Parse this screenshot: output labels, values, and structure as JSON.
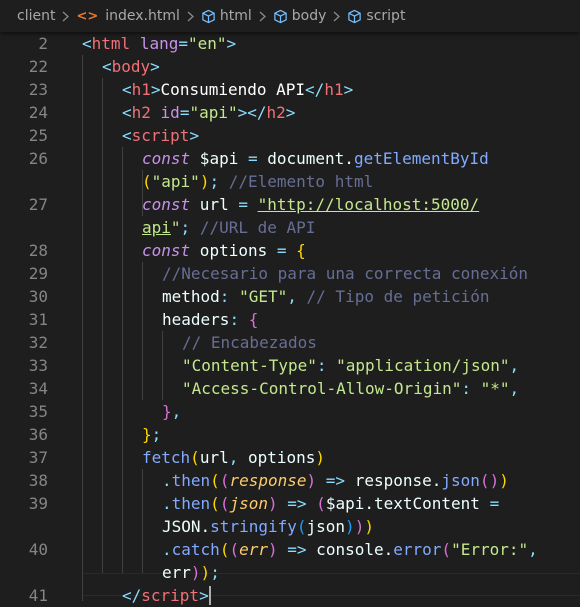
{
  "breadcrumb": {
    "items": [
      "client",
      "index.html",
      "html",
      "body",
      "script"
    ]
  },
  "editor": {
    "lines": [
      {
        "n": "2",
        "tokens": [
          [
            "pun",
            "<"
          ],
          [
            "tagn",
            "html"
          ],
          [
            "txt",
            " "
          ],
          [
            "attr",
            "lang"
          ],
          [
            "pun",
            "="
          ],
          [
            "str",
            "\"en\""
          ],
          [
            "pun",
            ">"
          ]
        ]
      },
      {
        "n": "22",
        "tokens": [
          [
            "pun",
            "<"
          ],
          [
            "tagn",
            "body"
          ],
          [
            "pun",
            ">"
          ]
        ]
      },
      {
        "n": "23",
        "tokens": [
          [
            "pun",
            "<"
          ],
          [
            "tagn",
            "h1"
          ],
          [
            "pun",
            ">"
          ],
          [
            "wt",
            "Consumiendo API"
          ],
          [
            "pun",
            "</"
          ],
          [
            "tagn",
            "h1"
          ],
          [
            "pun",
            ">"
          ]
        ]
      },
      {
        "n": "24",
        "tokens": [
          [
            "pun",
            "<"
          ],
          [
            "tagn",
            "h2"
          ],
          [
            "txt",
            " "
          ],
          [
            "attr",
            "id"
          ],
          [
            "pun",
            "="
          ],
          [
            "str",
            "\"api\""
          ],
          [
            "pun",
            "></"
          ],
          [
            "tagn",
            "h2"
          ],
          [
            "pun",
            ">"
          ]
        ]
      },
      {
        "n": "25",
        "tokens": [
          [
            "pun",
            "<"
          ],
          [
            "tagn",
            "script"
          ],
          [
            "pun",
            ">"
          ]
        ]
      },
      {
        "n": "26",
        "tokens": [
          [
            "kw",
            "const"
          ],
          [
            "txt",
            " $api "
          ],
          [
            "op",
            "="
          ],
          [
            "txt",
            " document."
          ],
          [
            "fn",
            "getElementById"
          ]
        ]
      },
      {
        "n": "",
        "tokens": [
          [
            "br1",
            "("
          ],
          [
            "str",
            "\"api\""
          ],
          [
            "br1",
            ")"
          ],
          [
            "pun",
            ";"
          ],
          [
            "txt",
            " "
          ],
          [
            "cm",
            "//Elemento html"
          ]
        ]
      },
      {
        "n": "27",
        "tokens": [
          [
            "kw",
            "const"
          ],
          [
            "txt",
            " url "
          ],
          [
            "op",
            "="
          ],
          [
            "txt",
            " "
          ],
          [
            "strul",
            "\"http://localhost:5000/"
          ]
        ]
      },
      {
        "n": "",
        "tokens": [
          [
            "strul",
            "api"
          ],
          [
            "str",
            "\""
          ],
          [
            "pun",
            ";"
          ],
          [
            "txt",
            " "
          ],
          [
            "cm",
            "//URL de API"
          ]
        ]
      },
      {
        "n": "28",
        "tokens": [
          [
            "kw",
            "const"
          ],
          [
            "txt",
            " options "
          ],
          [
            "op",
            "="
          ],
          [
            "txt",
            " "
          ],
          [
            "br1",
            "{"
          ]
        ]
      },
      {
        "n": "29",
        "tokens": [
          [
            "cm",
            "//Necesario para una correcta conexión"
          ]
        ]
      },
      {
        "n": "30",
        "tokens": [
          [
            "txt",
            "method"
          ],
          [
            "pun",
            ":"
          ],
          [
            "txt",
            " "
          ],
          [
            "str",
            "\"GET\""
          ],
          [
            "pun",
            ","
          ],
          [
            "txt",
            " "
          ],
          [
            "cm",
            "// Tipo de petición"
          ]
        ]
      },
      {
        "n": "31",
        "tokens": [
          [
            "txt",
            "headers"
          ],
          [
            "pun",
            ":"
          ],
          [
            "txt",
            " "
          ],
          [
            "br2",
            "{"
          ]
        ]
      },
      {
        "n": "32",
        "tokens": [
          [
            "cm",
            "// Encabezados"
          ]
        ]
      },
      {
        "n": "33",
        "tokens": [
          [
            "str",
            "\"Content-Type\""
          ],
          [
            "pun",
            ":"
          ],
          [
            "txt",
            " "
          ],
          [
            "str",
            "\"application/json\""
          ],
          [
            "pun",
            ","
          ]
        ]
      },
      {
        "n": "34",
        "tokens": [
          [
            "str",
            "\"Access-Control-Allow-Origin\""
          ],
          [
            "pun",
            ":"
          ],
          [
            "txt",
            " "
          ],
          [
            "str",
            "\"*\""
          ],
          [
            "pun",
            ","
          ]
        ]
      },
      {
        "n": "35",
        "tokens": [
          [
            "br2",
            "}"
          ],
          [
            "pun",
            ","
          ]
        ]
      },
      {
        "n": "36",
        "tokens": [
          [
            "br1",
            "}"
          ],
          [
            "pun",
            ";"
          ]
        ]
      },
      {
        "n": "37",
        "tokens": [
          [
            "fn",
            "fetch"
          ],
          [
            "br1",
            "("
          ],
          [
            "txt",
            "url"
          ],
          [
            "pun",
            ","
          ],
          [
            "txt",
            " options"
          ],
          [
            "br1",
            ")"
          ]
        ]
      },
      {
        "n": "38",
        "tokens": [
          [
            "pun",
            "."
          ],
          [
            "fn",
            "then"
          ],
          [
            "br1",
            "("
          ],
          [
            "br2",
            "("
          ],
          [
            "par",
            "response"
          ],
          [
            "br2",
            ")"
          ],
          [
            "txt",
            " "
          ],
          [
            "op",
            "=>"
          ],
          [
            "txt",
            " response."
          ],
          [
            "fn",
            "json"
          ],
          [
            "br2",
            "("
          ],
          [
            "br2",
            ")"
          ],
          [
            "br1",
            ")"
          ]
        ]
      },
      {
        "n": "39",
        "tokens": [
          [
            "pun",
            "."
          ],
          [
            "fn",
            "then"
          ],
          [
            "br1",
            "("
          ],
          [
            "br2",
            "("
          ],
          [
            "par",
            "json"
          ],
          [
            "br2",
            ")"
          ],
          [
            "txt",
            " "
          ],
          [
            "op",
            "=>"
          ],
          [
            "txt",
            " "
          ],
          [
            "br2",
            "("
          ],
          [
            "txt",
            "$api.textContent "
          ],
          [
            "op",
            "="
          ]
        ]
      },
      {
        "n": "",
        "tokens": [
          [
            "txt",
            "JSON."
          ],
          [
            "fn",
            "stringify"
          ],
          [
            "br3",
            "("
          ],
          [
            "txt",
            "json"
          ],
          [
            "br3",
            ")"
          ],
          [
            "br2",
            ")"
          ],
          [
            "br1",
            ")"
          ]
        ]
      },
      {
        "n": "40",
        "tokens": [
          [
            "pun",
            "."
          ],
          [
            "fn",
            "catch"
          ],
          [
            "br1",
            "("
          ],
          [
            "br2",
            "("
          ],
          [
            "par",
            "err"
          ],
          [
            "br2",
            ")"
          ],
          [
            "txt",
            " "
          ],
          [
            "op",
            "=>"
          ],
          [
            "txt",
            " console."
          ],
          [
            "fn",
            "error"
          ],
          [
            "br2",
            "("
          ],
          [
            "str",
            "\"Error:\""
          ],
          [
            "pun",
            ","
          ]
        ]
      },
      {
        "n": "",
        "tokens": [
          [
            "txt",
            "err"
          ],
          [
            "br2",
            ")"
          ],
          [
            "br1",
            ")"
          ],
          [
            "pun",
            ";"
          ]
        ]
      },
      {
        "n": "41",
        "tokens": [
          [
            "pun",
            "</"
          ],
          [
            "tagn",
            "script"
          ],
          [
            "pun",
            ">"
          ]
        ]
      }
    ]
  },
  "colors": {
    "background": "#1e1e1e",
    "line_number": "#858585",
    "tag": "#f07178",
    "string": "#c3e88d",
    "keyword": "#c792ea",
    "comment": "#676e95",
    "function": "#82aaff"
  },
  "icons": {
    "file": "html-file-icon",
    "element": "cube-icon",
    "separator": "chevron-right-icon"
  }
}
